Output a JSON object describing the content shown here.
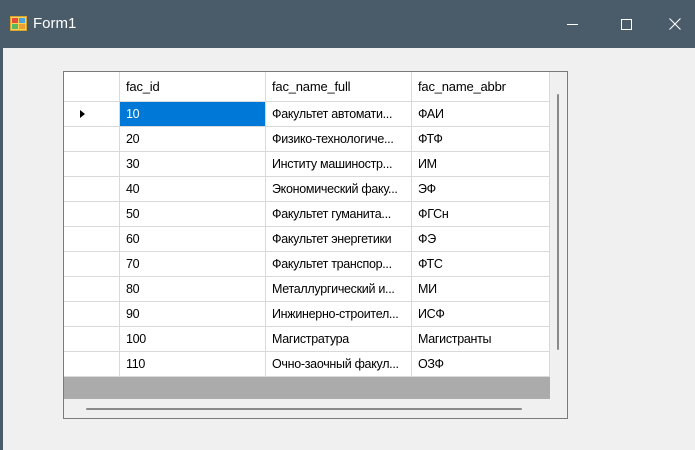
{
  "window": {
    "title": "Form1",
    "title_bar_color": "#4a5b6a",
    "icons": {
      "app": "form-app-icon",
      "minimize": "minimize-icon",
      "maximize": "maximize-icon",
      "close": "close-icon"
    },
    "close_glyph": "✕"
  },
  "grid": {
    "columns": [
      "fac_id",
      "fac_name_full",
      "fac_name_abbr"
    ],
    "selected_color": "#0078d7",
    "current_row_indicator": "row-pointer-icon",
    "rows": [
      [
        "10",
        "Факультет автомати...",
        "ФАИ"
      ],
      [
        "20",
        "Физико-технологиче...",
        "ФТФ"
      ],
      [
        "30",
        "Институ машиностр...",
        "ИМ"
      ],
      [
        "40",
        "Экономический факу...",
        "ЭФ"
      ],
      [
        "50",
        "Факультет гуманита...",
        "ФГСн"
      ],
      [
        "60",
        "Факультет энергетики",
        "ФЭ"
      ],
      [
        "70",
        "Факультет транспор...",
        "ФТС"
      ],
      [
        "80",
        "Металлургический и...",
        "МИ"
      ],
      [
        "90",
        "Инжинерно-строител...",
        "ИСФ"
      ],
      [
        "100",
        "Магистратура",
        "Магистранты"
      ],
      [
        "110",
        "Очно-заочный факул...",
        "ОЗФ"
      ]
    ]
  }
}
